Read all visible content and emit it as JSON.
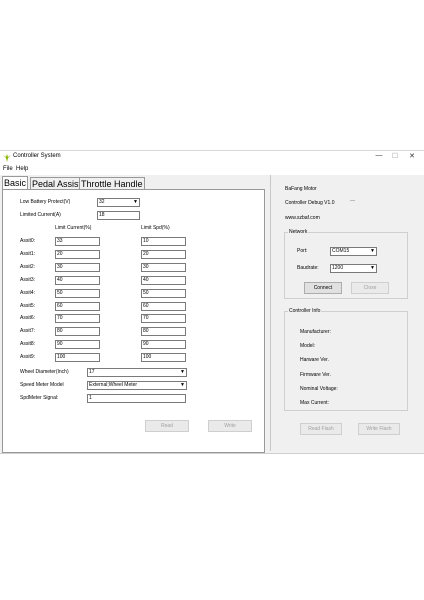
{
  "window": {
    "title": "Controller System",
    "minimize": "—",
    "maximize": "☐",
    "close": "✕"
  },
  "menu": [
    "File",
    "Help"
  ],
  "tabs": [
    "Basic",
    "Pedal Assist",
    "Throttle Handle"
  ],
  "basic": {
    "low_battery_label": "Low Battery Protect(V)",
    "low_battery_value": "32",
    "limited_current_label": "Limited Current(A)",
    "limited_current_value": "18",
    "limit_current_header": "Limit Current(%)",
    "limit_spd_header": "Limit Spd(%)",
    "assists": [
      {
        "label": "Assit0:",
        "current": "33",
        "spd": "10"
      },
      {
        "label": "Assit1:",
        "current": "20",
        "spd": "20"
      },
      {
        "label": "Assit2:",
        "current": "30",
        "spd": "30"
      },
      {
        "label": "Assit3:",
        "current": "40",
        "spd": "40"
      },
      {
        "label": "Assit4:",
        "current": "50",
        "spd": "50"
      },
      {
        "label": "Assit5:",
        "current": "60",
        "spd": "60"
      },
      {
        "label": "Assit6:",
        "current": "70",
        "spd": "70"
      },
      {
        "label": "Assit7:",
        "current": "80",
        "spd": "80"
      },
      {
        "label": "Assit8:",
        "current": "90",
        "spd": "90"
      },
      {
        "label": "Assit9:",
        "current": "100",
        "spd": "100"
      }
    ],
    "wheel_diameter_label": "Wheel Diameter(Inch)",
    "wheel_diameter_value": "17",
    "speed_meter_model_label": "Speed Meter Model",
    "speed_meter_model_value": "External;Wheel Meter",
    "spdmeter_signal_label": "SpdMeter Signal:",
    "spdmeter_signal_value": "1",
    "read_button": "Read",
    "write_button": "Write"
  },
  "info": {
    "company": "BaFang Motor",
    "product": "Controller Debug V1.0",
    "website": "www.szbaf.com"
  },
  "network": {
    "group_title": "Network",
    "port_label": "Port:",
    "port_value": "COM15",
    "baudrate_label": "Baudrate:",
    "baudrate_value": "1200",
    "connect_button": "Connect",
    "close_button": "Close"
  },
  "controller_info": {
    "group_title": "Controller Info",
    "labels": [
      "Manufacturer:",
      "Model:",
      "Harware Ver.",
      "Firmware Ver.",
      "Nominal Voltage:",
      "Max Current:"
    ]
  },
  "flash": {
    "read_button": "Read Flash",
    "write_button": "Write Flash"
  }
}
